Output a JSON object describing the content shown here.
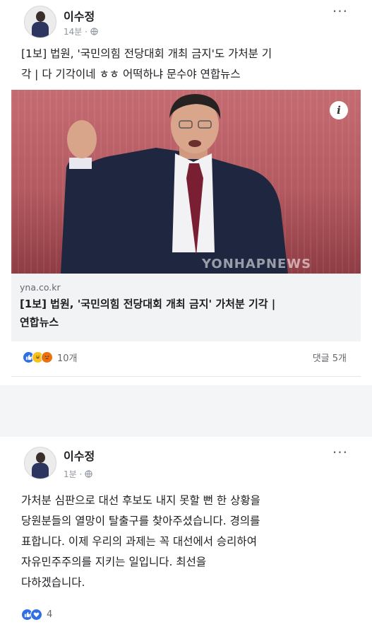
{
  "post1": {
    "author": "이수정",
    "time": "14분",
    "privacy_icon": "globe-icon",
    "text_line1": "[1보] 법원, '국민의힘 전당대회 개최 금지'도  가처분 기",
    "text_line2": "각 | 다 기각이네 ㅎㅎ 어떡하냐 문수야  연합뉴스",
    "image": {
      "watermark": "YONHAPNEWS",
      "info_label": "i"
    },
    "link": {
      "domain": "yna.co.kr",
      "title_line1": "[1보] 법원, '국민의힘 전당대회 개최 금지' 가처분 기각 |",
      "title_line2": "연합뉴스"
    },
    "reactions": {
      "icons": [
        "like-icon",
        "haha-icon",
        "angry-icon"
      ],
      "count": "10개"
    },
    "comments": "댓글 5개"
  },
  "post2": {
    "author": "이수정",
    "time": "1분",
    "privacy_icon": "globe-icon",
    "text_lines": [
      "가처분 심판으로 대선 후보도 내지 못할 뻔 한 상황을",
      "당원분들의 열망이 탈출구를 찾아주셨습니다. 경의를",
      "표합니다. 이제 우리의 과제는 꼭 대선에서 승리하여",
      "자유민주주의를 지키는 일입니다. 최선을",
      "다하겠습니다."
    ],
    "reactions": {
      "icons": [
        "like-icon",
        "love-icon"
      ],
      "count": "4"
    }
  },
  "more_label": "···",
  "colors": {
    "accent": "#2f6fe6",
    "photo_bg": "#b35960"
  }
}
